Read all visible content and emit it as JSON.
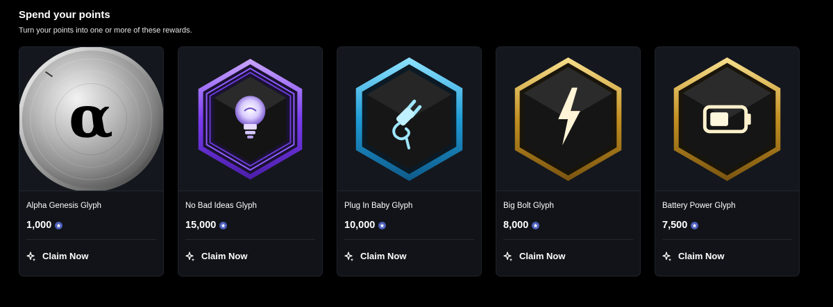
{
  "header": {
    "title": "Spend your points",
    "subtitle": "Turn your points into one or more of these rewards."
  },
  "rewards": [
    {
      "name": "Alpha Genesis Glyph",
      "price": "1,000",
      "claim_label": "Claim Now",
      "icon": "alpha-coin-icon",
      "accent": "#c0c0c0"
    },
    {
      "name": "No Bad Ideas Glyph",
      "price": "15,000",
      "claim_label": "Claim Now",
      "icon": "lightbulb-icon",
      "accent": "#8a4dff"
    },
    {
      "name": "Plug In Baby Glyph",
      "price": "10,000",
      "claim_label": "Claim Now",
      "icon": "plug-icon",
      "accent": "#2aa9e0"
    },
    {
      "name": "Big Bolt Glyph",
      "price": "8,000",
      "claim_label": "Claim Now",
      "icon": "bolt-icon",
      "accent": "#d6a636"
    },
    {
      "name": "Battery Power Glyph",
      "price": "7,500",
      "claim_label": "Claim Now",
      "icon": "battery-icon",
      "accent": "#d6a636"
    }
  ],
  "coin_symbol": "α",
  "colors": {
    "background": "#000000",
    "card": "#111318",
    "points_badge": "#4a5db8"
  }
}
